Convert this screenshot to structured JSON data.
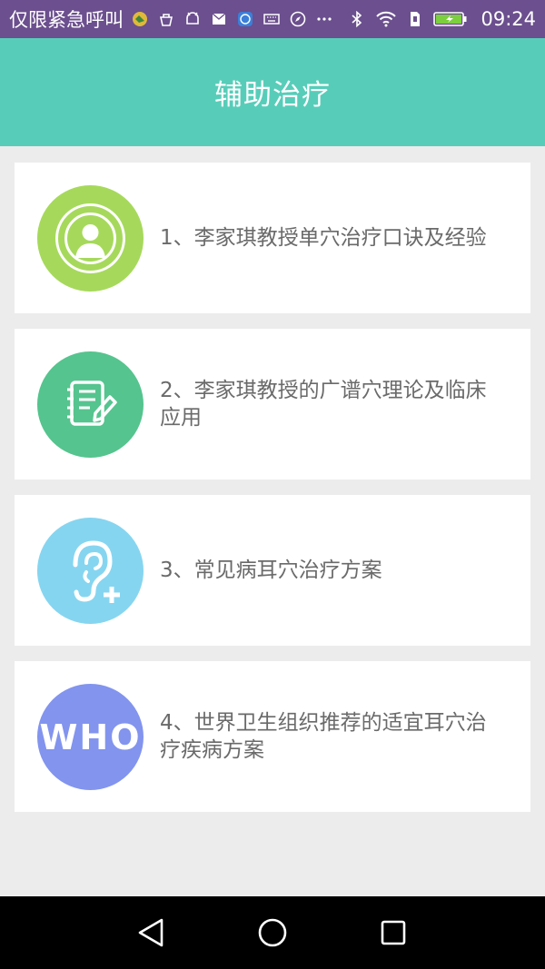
{
  "status_bar": {
    "carrier": "仅限紧急呼叫",
    "time": "09:24"
  },
  "app_bar": {
    "title": "辅助治疗"
  },
  "items": [
    {
      "label": "1、李家琪教授单穴治疗口诀及经验",
      "icon": "person-signal-icon",
      "color": "#a6d95b"
    },
    {
      "label": "2、李家琪教授的广谱穴理论及临床应用",
      "icon": "notepad-pencil-icon",
      "color": "#55c48e"
    },
    {
      "label": "3、常见病耳穴治疗方案",
      "icon": "ear-plus-icon",
      "color": "#86d5f0"
    },
    {
      "label": "4、世界卫生组织推荐的适宜耳穴治疗疾病方案",
      "icon": "who-logo-icon",
      "color": "#8294ee",
      "logo_text": "WHO"
    }
  ]
}
